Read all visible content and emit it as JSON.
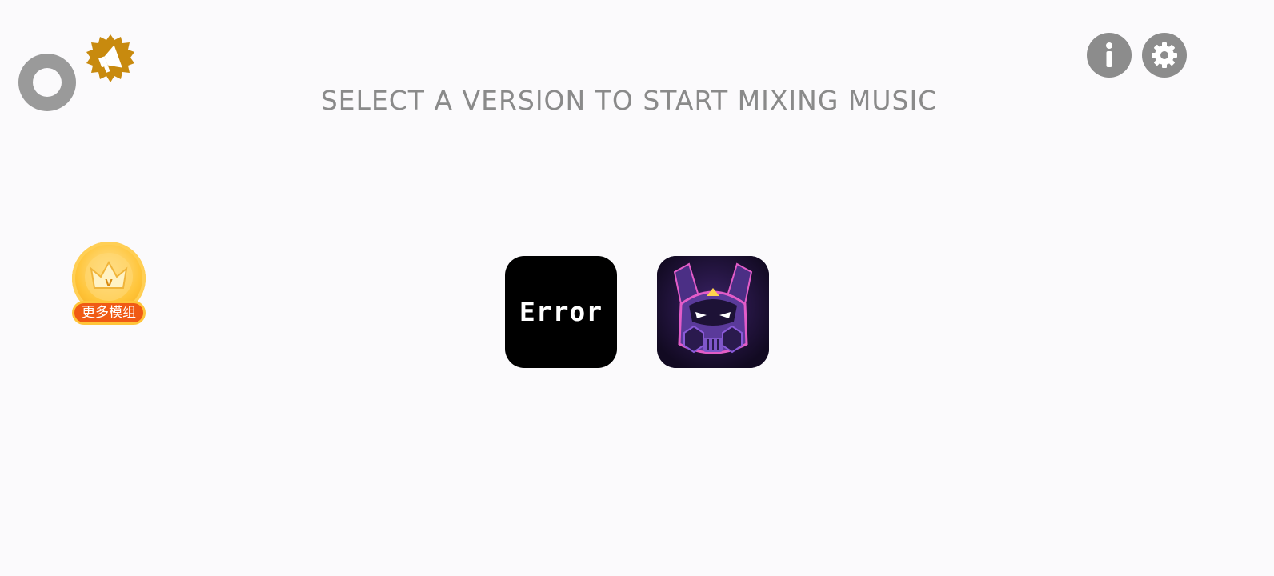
{
  "header": {
    "title": "SELECT A VERSION TO START MIXING MUSIC"
  },
  "icons": {
    "ring_button": "ring-toggle-icon",
    "megaphone_badge": "megaphone-icon",
    "info_button": "info-icon",
    "settings_button": "gear-icon",
    "more_mods_crown": "crown-icon"
  },
  "more_mods": {
    "label": "更多模组"
  },
  "versions": [
    {
      "label": "Error"
    },
    {
      "label": ""
    }
  ],
  "colors": {
    "background": "#fbfafc",
    "icon_gray": "#8c8c8c",
    "megaphone_gold": "#c88a0e",
    "badge_orange": "#f05a14",
    "badge_gold": "#ffc53a",
    "robot_purple": "#6b3fb5"
  }
}
